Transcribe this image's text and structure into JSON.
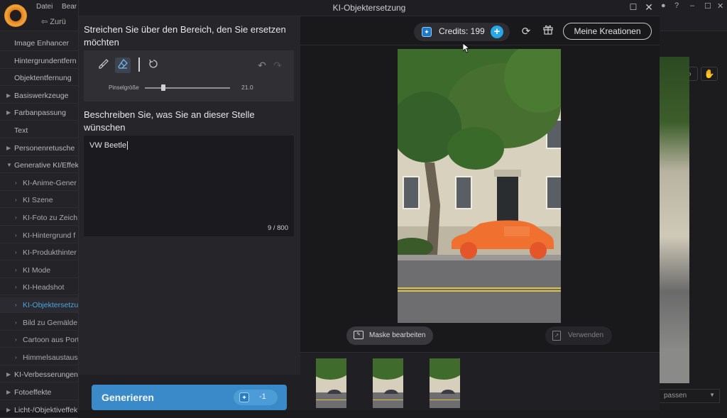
{
  "background_app": {
    "menu": [
      "Datei",
      "Bear"
    ],
    "back_label": "Zurü",
    "sidebar_items": [
      {
        "label": "Image Enhancer",
        "kind": "item"
      },
      {
        "label": "Hintergrundentfern",
        "kind": "item"
      },
      {
        "label": "Objektentfernung",
        "kind": "item"
      },
      {
        "label": "Basiswerkzeuge",
        "kind": "section"
      },
      {
        "label": "Farbanpassung",
        "kind": "section"
      },
      {
        "label": "Text",
        "kind": "item"
      },
      {
        "label": "Personenretusche",
        "kind": "section"
      },
      {
        "label": "Generative KI/Effekt",
        "kind": "section-open"
      },
      {
        "label": "KI-Anime-Gener",
        "kind": "sub"
      },
      {
        "label": "KI Szene",
        "kind": "sub"
      },
      {
        "label": "KI-Foto zu Zeich",
        "kind": "sub"
      },
      {
        "label": "KI-Hintergrund f",
        "kind": "sub"
      },
      {
        "label": "KI-Produkthinter",
        "kind": "sub"
      },
      {
        "label": "KI Mode",
        "kind": "sub"
      },
      {
        "label": "KI-Headshot",
        "kind": "sub"
      },
      {
        "label": "KI-Objektersetzu",
        "kind": "sub-active"
      },
      {
        "label": "Bild zu Gemälde",
        "kind": "sub"
      },
      {
        "label": "Cartoon aus Port",
        "kind": "sub"
      },
      {
        "label": "Himmelsaustaus",
        "kind": "sub"
      },
      {
        "label": "KI-Verbesserungen",
        "kind": "section"
      },
      {
        "label": "Fotoeffekte",
        "kind": "section"
      },
      {
        "label": "Licht-/Objektiveffek",
        "kind": "section"
      }
    ],
    "right_select_value": "passen"
  },
  "dialog": {
    "title": "KI-Objektersetzung",
    "brush_heading": "Streichen Sie über den Bereich, den Sie ersetzen möchten",
    "brush_size_label": "Pinselgröße",
    "brush_size_value": "21.0",
    "brush_size_level": 0.22,
    "describe_heading": "Beschreiben Sie, was Sie an dieser Stelle wünschen",
    "prompt_value": "VW Beetle",
    "char_count": "9 / 800",
    "generate_label": "Generieren",
    "generate_cost": "-1",
    "credits_label": "Credits: 199",
    "my_creations_label": "Meine Kreationen",
    "edit_mask_label": "Maske bearbeiten",
    "use_label": "Verwenden",
    "icons": {
      "brush": "paintbrush-icon",
      "eraser": "eraser-icon",
      "reset": "reset-icon",
      "undo": "undo-icon",
      "redo": "redo-icon",
      "credits": "credit-gem-icon",
      "add": "plus-icon",
      "refresh": "refresh-icon",
      "gift": "gift-icon"
    },
    "colors": {
      "accent": "#3a89c9",
      "highlight": "#4ba6e0",
      "credits_plus": "#27a7e8",
      "car_mask": "#f07030"
    }
  }
}
